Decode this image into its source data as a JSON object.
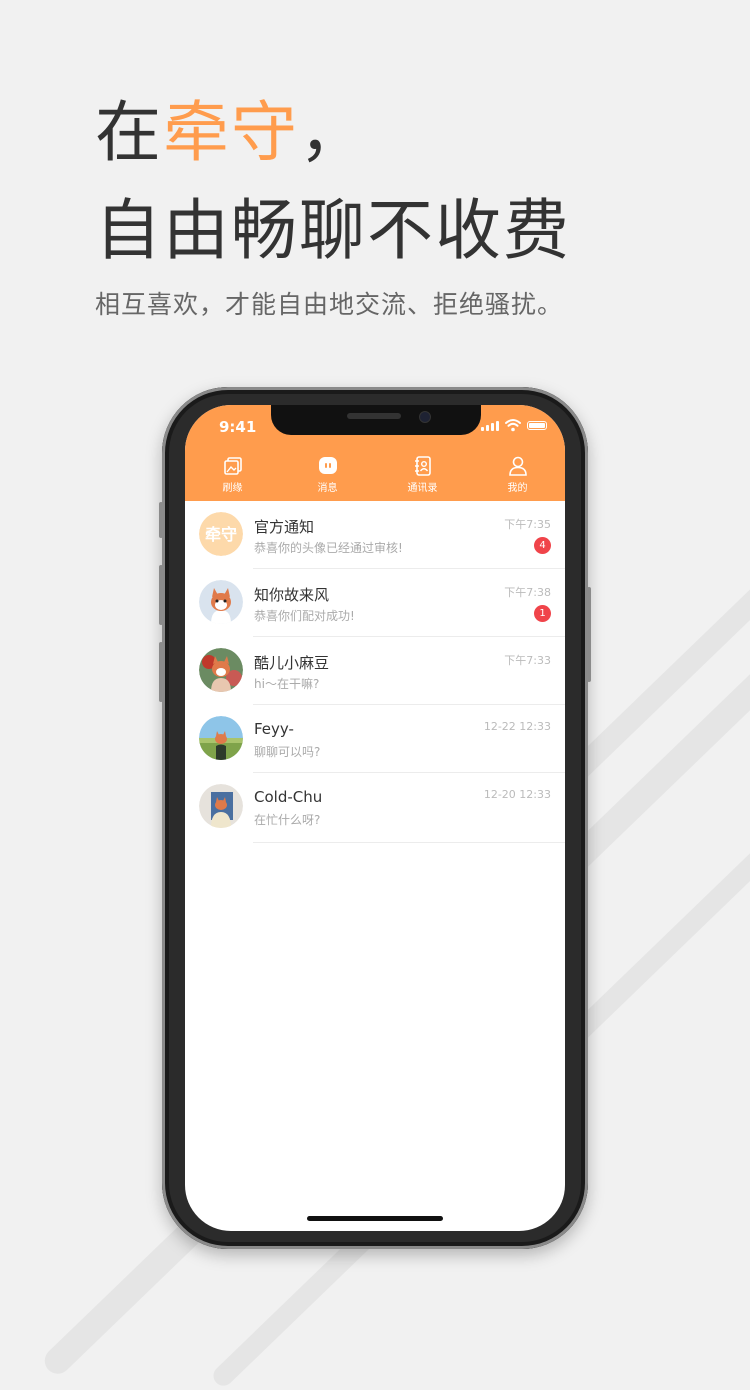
{
  "promo": {
    "title_prefix": "在",
    "title_brand": "牵守",
    "title_suffix": "，",
    "title_line2": "自由畅聊不收费",
    "subtitle": "相互喜欢，才能自由地交流、拒绝骚扰。",
    "accent_color": "#ff9c4d"
  },
  "status_bar": {
    "time": "9:41"
  },
  "tabs": [
    {
      "label": "刷缘",
      "icon": "photos-icon"
    },
    {
      "label": "消息",
      "icon": "chat-bubble-icon",
      "active": true
    },
    {
      "label": "通讯录",
      "icon": "contacts-book-icon"
    },
    {
      "label": "我的",
      "icon": "profile-icon"
    }
  ],
  "conversations": [
    {
      "name": "官方通知",
      "preview": "恭喜你的头像已经通过审核!",
      "time": "下午7:35",
      "unread": "4",
      "avatar_text": "牵守"
    },
    {
      "name": "知你故来风",
      "preview": "恭喜你们配对成功!",
      "time": "下午7:38",
      "unread": "1"
    },
    {
      "name": "酷儿小麻豆",
      "preview": "hi～在干嘛?",
      "time": "下午7:33"
    },
    {
      "name": "Feyy-",
      "preview": "聊聊可以吗?",
      "time": "12-22 12:33"
    },
    {
      "name": "Cold-Chu",
      "preview": "在忙什么呀?",
      "time": "12-20 12:33"
    }
  ],
  "colors": {
    "topbar": "#ff9c4d",
    "badge": "#f0444a",
    "background": "#f1f1f1"
  }
}
